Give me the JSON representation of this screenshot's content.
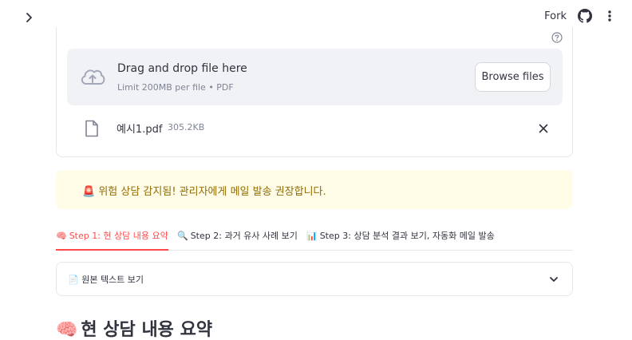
{
  "topbar": {
    "fork_label": "Fork",
    "icons": [
      "chevron-right-icon",
      "github-icon",
      "more-vertical-icon"
    ]
  },
  "uploader": {
    "help_icon": "help-circle-icon",
    "dropzone": {
      "title": "Drag and drop file here",
      "subtitle": "Limit 200MB per file • PDF",
      "button_label": "Browse files",
      "icon": "cloud-upload-icon"
    },
    "file": {
      "name": "예시1.pdf",
      "size": "305.2KB",
      "icon": "file-icon",
      "remove_icon": "close-icon"
    }
  },
  "alert": {
    "emoji": "🚨",
    "text": "위험 상담 감지됨! 관리자에게 메일 발송 권장합니다.",
    "background": "#fffce7",
    "text_color": "#926c05"
  },
  "tabs": [
    {
      "emoji": "🧠",
      "label": "Step 1: 현 상담 내용 요약",
      "active": true
    },
    {
      "emoji": "🔍",
      "label": "Step 2: 과거 유사 사례 보기",
      "active": false
    },
    {
      "emoji": "📊",
      "label": "Step 3: 상담 분석 결과 보기, 자동화 메일 발송",
      "active": false
    }
  ],
  "expander": {
    "emoji": "📄",
    "label": "원본 텍스트 보기",
    "chevron_icon": "chevron-down-icon"
  },
  "section": {
    "emoji": "🧠",
    "heading": "현 상담 내용 요약"
  },
  "colors": {
    "accent": "#ff4b4b",
    "muted_text": "#808495",
    "dropzone_bg": "#f0f2f6"
  }
}
